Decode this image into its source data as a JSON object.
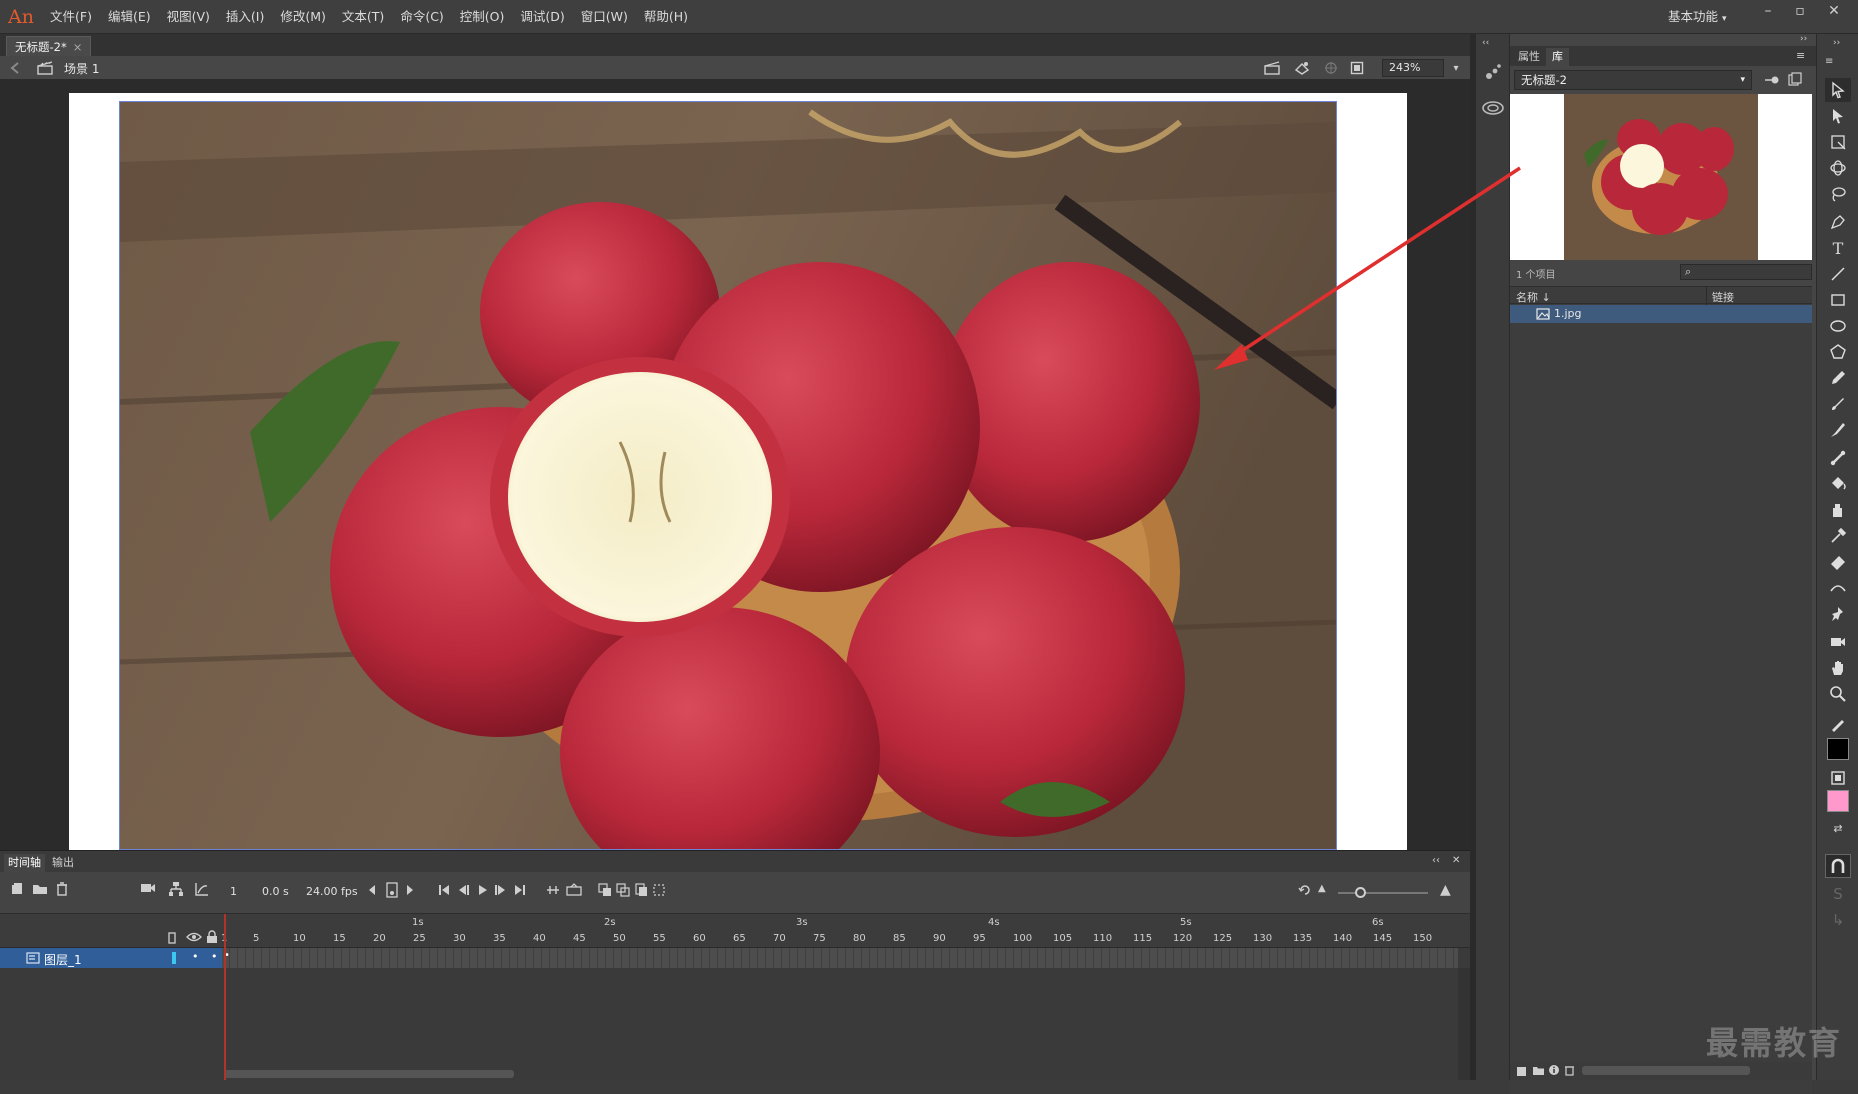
{
  "app": {
    "logo": "An"
  },
  "menu": [
    "文件(F)",
    "编辑(E)",
    "视图(V)",
    "插入(I)",
    "修改(M)",
    "文本(T)",
    "命令(C)",
    "控制(O)",
    "调试(D)",
    "窗口(W)",
    "帮助(H)"
  ],
  "workspace": {
    "label": "基本功能"
  },
  "document": {
    "tab": "无标题-2*",
    "scene": "场景 1",
    "zoom": "243%"
  },
  "timeline": {
    "tabs": [
      "时间轴",
      "输出"
    ],
    "current_frame": "1",
    "time": "0.0 s",
    "fps": "24.00 fps",
    "seconds": [
      "1s",
      "2s",
      "3s",
      "4s",
      "5s",
      "6s"
    ],
    "frame_numbers": [
      "1",
      "5",
      "10",
      "15",
      "20",
      "25",
      "30",
      "35",
      "40",
      "45",
      "50",
      "55",
      "60",
      "65",
      "70",
      "75",
      "80",
      "85",
      "90",
      "95",
      "100",
      "105",
      "110",
      "115",
      "120",
      "125",
      "130",
      "135",
      "140",
      "145",
      "150"
    ],
    "layer_name": "图层_1"
  },
  "library": {
    "tabs": [
      "属性",
      "库"
    ],
    "document": "无标题-2",
    "count": "1 个项目",
    "col_name": "名称",
    "col_link": "链接",
    "items": [
      {
        "name": "1.jpg"
      }
    ]
  },
  "watermark": "最需教育",
  "colors": {
    "stroke": "#000000",
    "fill": "#ff99cc",
    "accent": "#2f5e99",
    "playhead": "#b2332b"
  },
  "icons": [
    "selection-tool-icon",
    "subselection-tool-icon",
    "free-transform-icon",
    "3d-rotation-icon",
    "lasso-icon",
    "pen-icon",
    "text-icon",
    "line-icon",
    "rectangle-icon",
    "oval-icon",
    "polystar-icon",
    "pencil-icon",
    "paint-brush-icon",
    "brush-icon",
    "bone-icon",
    "paint-bucket-icon",
    "ink-bottle-icon",
    "eyedropper-icon",
    "eraser-icon",
    "width-icon",
    "pin-icon",
    "camera-icon",
    "hand-icon",
    "zoom-icon"
  ]
}
